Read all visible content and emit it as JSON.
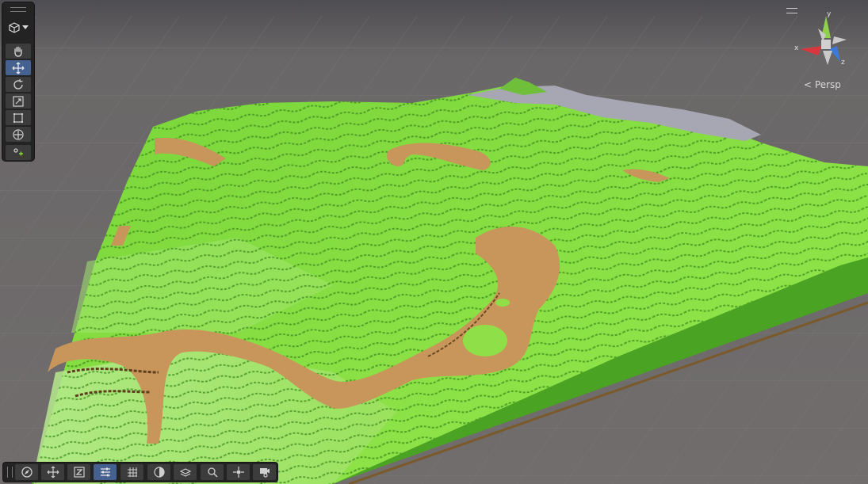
{
  "scene": {
    "background_color": "#6e6b6c",
    "terrain_top_color": "#7fdc3a",
    "terrain_side_color": "#4faa25",
    "terrain_path_color": "#c8955a",
    "terrain_rock_color": "#a9a9b3"
  },
  "tool_palette": {
    "view_dropdown_icon": "cube-icon",
    "tools": [
      {
        "name": "view-tool",
        "icon": "hand-icon",
        "active": false
      },
      {
        "name": "move-tool",
        "icon": "move-icon",
        "active": true
      },
      {
        "name": "rotate-tool",
        "icon": "rotate-icon",
        "active": false
      },
      {
        "name": "scale-tool",
        "icon": "scale-icon",
        "active": false
      },
      {
        "name": "rect-tool",
        "icon": "rect-icon",
        "active": false
      },
      {
        "name": "transform-tool",
        "icon": "transform-icon",
        "active": false
      },
      {
        "name": "custom-tool",
        "icon": "custom-tool-icon",
        "active": false
      }
    ]
  },
  "overlay_toolbar": {
    "buttons": [
      {
        "name": "draw-mode-button",
        "icon": "compass-icon"
      },
      {
        "name": "move-snap-button",
        "icon": "move-icon"
      },
      {
        "name": "view-options-button",
        "icon": "box-z-icon"
      },
      {
        "name": "settings-button",
        "icon": "sliders-icon"
      },
      {
        "name": "grid-button",
        "icon": "grid-icon"
      },
      {
        "name": "lighting-button",
        "icon": "lighting-icon"
      },
      {
        "name": "effects-button",
        "icon": "layers-icon"
      },
      {
        "name": "search-button",
        "icon": "search-icon"
      },
      {
        "name": "pivot-button",
        "icon": "pivot-icon"
      },
      {
        "name": "camera-button",
        "icon": "camera-icon"
      }
    ]
  },
  "orientation_gizmo": {
    "projection_label": "Persp",
    "axes": {
      "x": "x",
      "y": "y",
      "z": "z"
    },
    "x_color": "#d9363e",
    "y_color": "#8fd14a",
    "z_color": "#3d79d6"
  }
}
